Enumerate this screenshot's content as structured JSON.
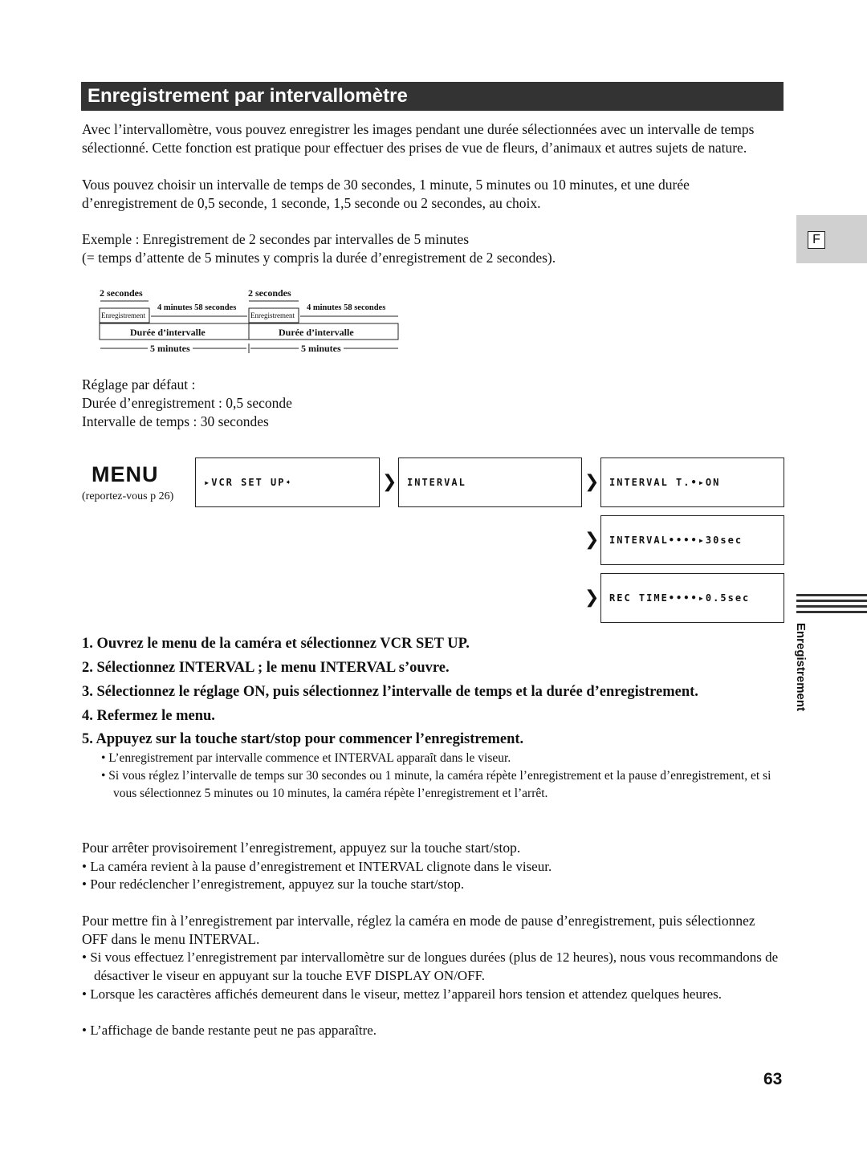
{
  "title": "Enregistrement par intervallomètre",
  "intro": [
    "Avec l’intervallomètre, vous pouvez enregistrer les images pendant une durée sélectionnées avec un intervalle de temps sélectionné. Cette fonction est pratique pour effectuer des prises de vue de fleurs, d’animaux et autres sujets de nature.",
    "Vous pouvez choisir un intervalle de temps de 30 secondes, 1 minute, 5 minutes ou 10 minutes, et une durée d’enregistrement de 0,5 seconde, 1 seconde, 1,5 seconde ou 2 secondes, au choix."
  ],
  "example": [
    "Exemple : Enregistrement de 2 secondes par intervalles de 5 minutes",
    "(= temps d’attente de 5 minutes y compris la durée d’enregistrement de 2 secondes)."
  ],
  "diagram": {
    "rec_time": "2 secondes",
    "wait": "4 minutes 58 secondes",
    "rec_label": "Enregistrement",
    "interval_label": "Durée d’intervalle",
    "period": "5 minutes"
  },
  "defaults": [
    "Réglage par défaut :",
    "Durée d’enregistrement : 0,5 seconde",
    "Intervalle de temps : 30 secondes"
  ],
  "menu": {
    "logo": "MENU",
    "ref": "(reportez-vous p 26)",
    "boxes": [
      "▸VCR SET UP➧",
      "INTERVAL",
      "INTERVAL T.•▸ON",
      "INTERVAL••••▸30sec",
      "REC TIME••••▸0.5sec"
    ]
  },
  "steps": [
    "1. Ouvrez le menu de la caméra et sélectionnez VCR SET UP.",
    "2. Sélectionnez INTERVAL ; le menu INTERVAL s’ouvre.",
    "3. Sélectionnez le réglage ON, puis sélectionnez l’intervalle de temps et la durée d’enregistrement.",
    "4. Refermez le menu.",
    "5. Appuyez sur la touche start/stop pour commencer l’enregistrement."
  ],
  "step_notes": [
    "• L’enregistrement par intervalle commence et INTERVAL apparaît dans le viseur.",
    "• Si vous réglez l’intervalle de temps sur 30 secondes ou 1 minute, la caméra répète l’enregistrement et la pause d’enregistrement, et si vous sélectionnez 5 minutes ou 10 minutes, la caméra répète l’enregistrement et l’arrêt."
  ],
  "pause": {
    "text": "Pour arrêter provisoirement l’enregistrement, appuyez sur la touche start/stop.",
    "bullets": [
      "• La caméra revient à la pause d’enregistrement et INTERVAL clignote dans le viseur.",
      "• Pour redéclencher l’enregistrement, appuyez sur la touche start/stop."
    ]
  },
  "end": {
    "text": "Pour mettre fin à l’enregistrement par intervalle, réglez la caméra en mode de pause d’enregistrement, puis sélectionnez OFF dans le menu INTERVAL.",
    "bullets": [
      "• Si vous effectuez l’enregistrement par intervallomètre sur de longues durées (plus de 12 heures), nous vous recommandons de désactiver le viseur en appuyant sur la touche EVF DISPLAY ON/OFF.",
      "• Lorsque les caractères affichés demeurent dans le viseur, mettez l’appareil hors tension et attendez quelques heures.",
      "• L’affichage de bande restante peut ne pas apparaître."
    ]
  },
  "side": {
    "lang": "F",
    "section": "Enregistrement"
  },
  "page_number": "63"
}
